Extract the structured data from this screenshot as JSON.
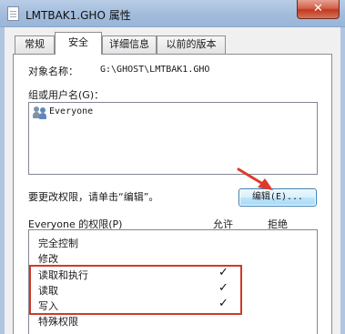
{
  "window": {
    "title": "LMTBAK1.GHO 属性",
    "close_glyph": "✕"
  },
  "tabs": [
    {
      "label": "常规"
    },
    {
      "label": "安全"
    },
    {
      "label": "详细信息"
    },
    {
      "label": "以前的版本"
    }
  ],
  "security": {
    "object_name_label": "对象名称：",
    "object_name_value": "G:\\GHOST\\LMTBAK1.GHO",
    "group_label": "组或用户名(G)：",
    "users": [
      {
        "name": "Everyone",
        "icon": "users-icon"
      }
    ],
    "change_hint": "要更改权限，请单击“编辑”。",
    "edit_button": "编辑(E)...",
    "perm_header": "Everyone 的权限(P)",
    "allow_header": "允许",
    "deny_header": "拒绝",
    "permissions": [
      {
        "name": "完全控制",
        "allow": "",
        "deny": ""
      },
      {
        "name": "修改",
        "allow": "",
        "deny": ""
      },
      {
        "name": "读取和执行",
        "allow": "✓",
        "deny": ""
      },
      {
        "name": "读取",
        "allow": "✓",
        "deny": ""
      },
      {
        "name": "写入",
        "allow": "✓",
        "deny": ""
      },
      {
        "name": "特殊权限",
        "allow": "",
        "deny": ""
      }
    ]
  },
  "colors": {
    "highlight_box": "#d03a2a",
    "arrow": "#e0392b"
  }
}
